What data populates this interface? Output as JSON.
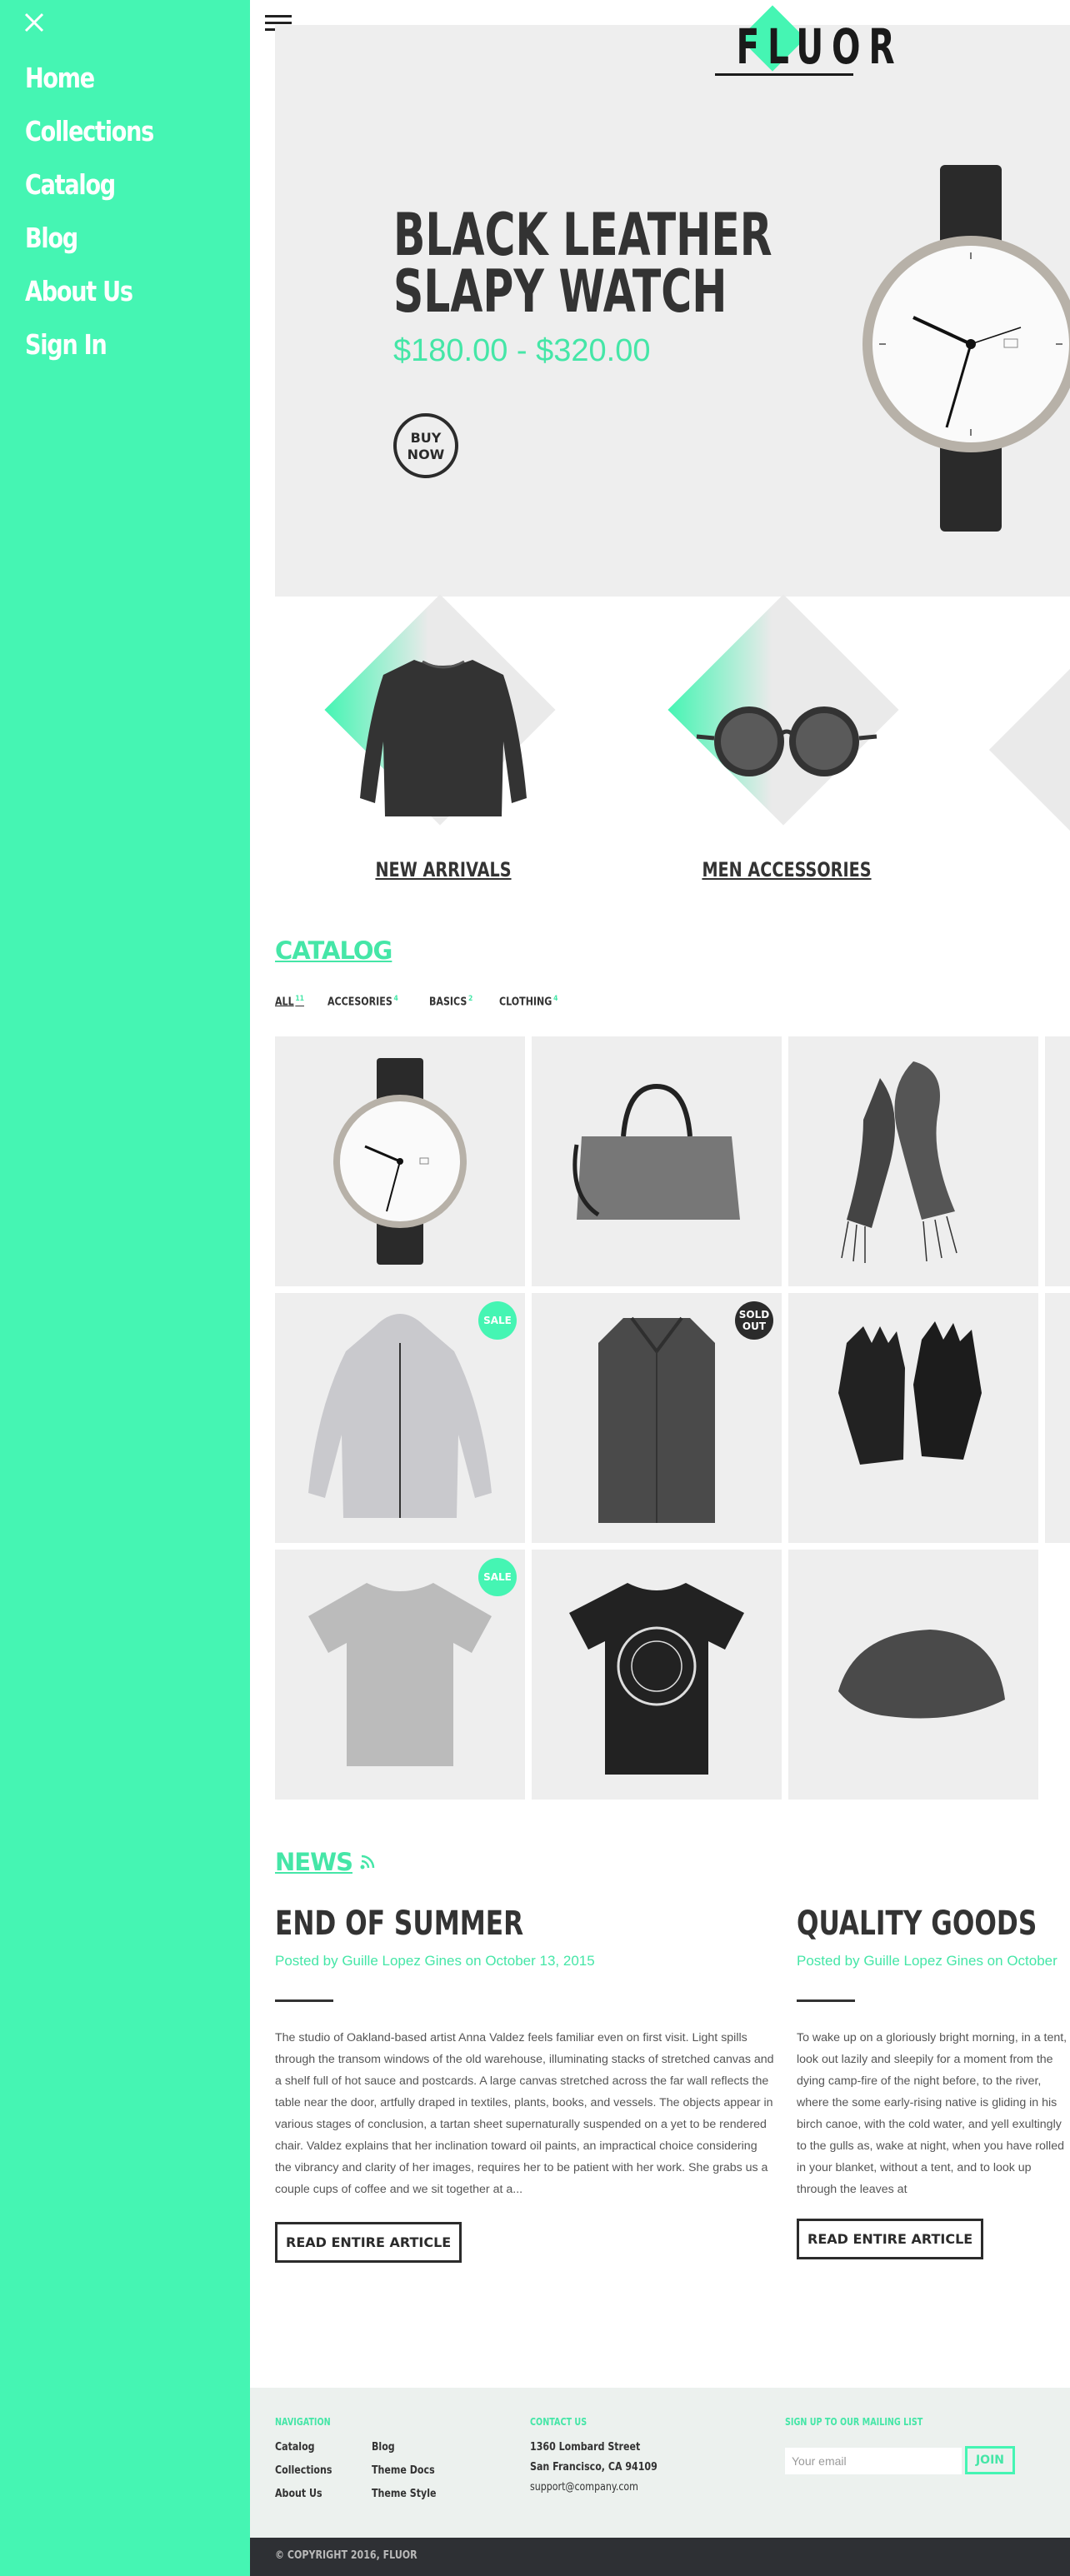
{
  "brand": "FLUOR",
  "colors": {
    "accent": "#45f5b3",
    "dark": "#2b2b2b",
    "panel": "#eeeeee"
  },
  "sidebar": {
    "close_icon": "close-icon",
    "items": [
      {
        "label": "Home"
      },
      {
        "label": "Collections"
      },
      {
        "label": "Catalog"
      },
      {
        "label": "Blog"
      },
      {
        "label": "About Us"
      },
      {
        "label": "Sign In"
      }
    ]
  },
  "header": {
    "menu_icon": "hamburger-icon",
    "logo": "FLUOR"
  },
  "hero": {
    "title_line1": "BLACK LEATHER",
    "title_line2": "SLAPY WATCH",
    "price": "$180.00 - $320.00",
    "buy_line1": "BUY",
    "buy_line2": "NOW",
    "image": "wristwatch"
  },
  "collections": [
    {
      "label": "NEW ARRIVALS",
      "image": "sweatshirt"
    },
    {
      "label": "MEN ACCESSORIES",
      "image": "sunglasses"
    }
  ],
  "catalog": {
    "title": "CATALOG",
    "filters": [
      {
        "label": "ALL",
        "count": "11",
        "active": true
      },
      {
        "label": "ACCESORIES",
        "count": "4"
      },
      {
        "label": "BASICS",
        "count": "2"
      },
      {
        "label": "CLOTHING",
        "count": "4"
      }
    ],
    "products": [
      {
        "image": "watch",
        "badge": ""
      },
      {
        "image": "bag",
        "badge": ""
      },
      {
        "image": "scarf",
        "badge": ""
      },
      {
        "image": "jacket",
        "badge": "SALE"
      },
      {
        "image": "shirt",
        "badge": "SOLD OUT"
      },
      {
        "image": "gloves",
        "badge": ""
      },
      {
        "image": "tshirt-grey",
        "badge": "SALE"
      },
      {
        "image": "tshirt-black",
        "badge": ""
      },
      {
        "image": "cap",
        "badge": ""
      }
    ]
  },
  "news": {
    "title": "NEWS",
    "rss_icon": "rss-icon",
    "articles": [
      {
        "title": "END OF SUMMER",
        "meta": "Posted by Guille Lopez Gines on October 13, 2015",
        "body": "The studio of Oakland-based artist Anna Valdez feels familiar even on first visit. Light spills through the transom windows of the old warehouse, illuminating stacks of stretched canvas and a shelf full of hot sauce and postcards. A large canvas stretched across the far wall reflects the table near the door, artfully draped in textiles, plants, books, and vessels. The objects appear in various stages of conclusion, a tartan sheet supernaturally suspended on a yet to be rendered chair. Valdez explains that her inclination toward oil paints, an impractical choice considering the vibrancy and clarity of her images, requires her to be patient with her work. She grabs us a couple cups of coffee and we sit together at a...",
        "button": "READ ENTIRE ARTICLE"
      },
      {
        "title": "QUALITY GOODS",
        "meta": "Posted by Guille Lopez Gines on October",
        "body": "To wake up on a gloriously bright morning, in a tent, look out lazily and sleepily for a moment from the dying camp-fire of the night before, to the river, where the some early-rising native is gliding in his birch canoe, with the cold water, and yell exultingly to the gulls as, wake at night, when you have rolled in your blanket, without a tent, and to look up through the leaves at",
        "button": "READ ENTIRE ARTICLE"
      }
    ]
  },
  "footer": {
    "navigation_heading": "NAVIGATION",
    "nav_col1": [
      "Catalog",
      "Collections",
      "About Us"
    ],
    "nav_col2": [
      "Blog",
      "Theme Docs",
      "Theme Style"
    ],
    "contact_heading": "CONTACT US",
    "address_line1": "1360 Lombard Street",
    "address_line2": "San Francisco, CA 94109",
    "email": "support@company.com",
    "mailing_heading": "SIGN UP TO OUR MAILING LIST",
    "email_placeholder": "Your email",
    "join_label": "JOIN",
    "copyright": "© COPYRIGHT 2016, FLUOR"
  }
}
